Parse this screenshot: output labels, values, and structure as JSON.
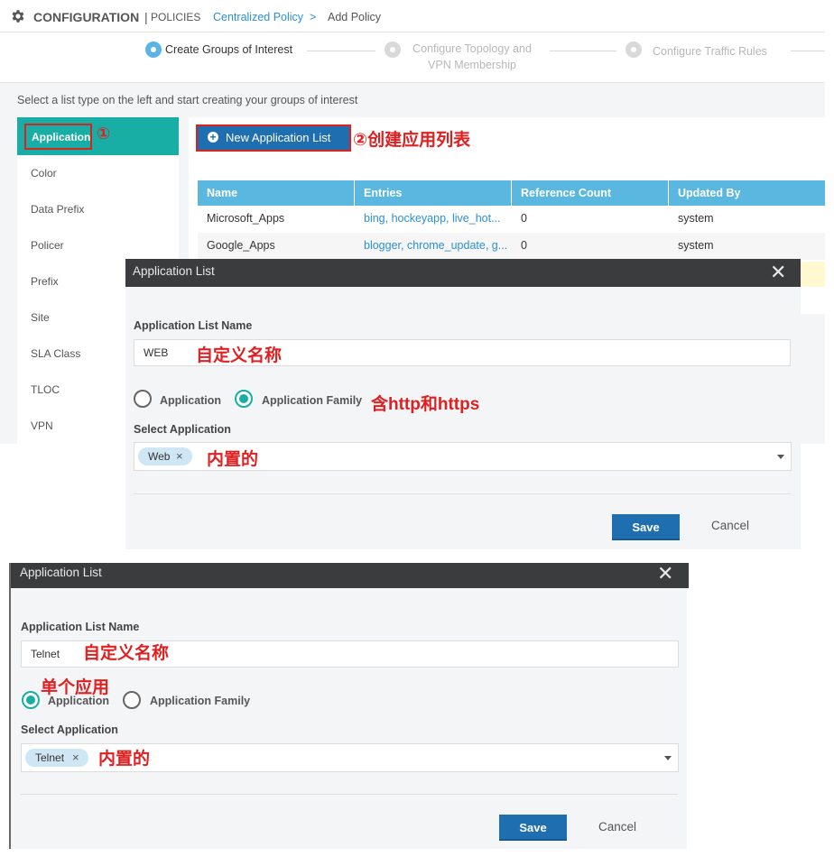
{
  "header": {
    "title": "CONFIGURATION",
    "separator": "|",
    "subtitle": "POLICIES",
    "breadcrumb_link": "Centralized Policy",
    "breadcrumb_arrow": ">",
    "breadcrumb_current": "Add Policy"
  },
  "wizard": {
    "steps": [
      {
        "label": "Create Groups of Interest",
        "active": true
      },
      {
        "label_line1": "Configure Topology and",
        "label_line2": "VPN Membership",
        "active": false
      },
      {
        "label": "Configure Traffic Rules",
        "active": false
      }
    ]
  },
  "instruction": "Select a list type on the left and start creating your groups of interest",
  "sidebar": {
    "active_item": "Application",
    "active_annotation": "①",
    "items": [
      "Color",
      "Data Prefix",
      "Policer",
      "Prefix",
      "Site",
      "SLA Class",
      "TLOC",
      "VPN"
    ]
  },
  "main": {
    "new_button_icon": "plus-circle-icon",
    "new_button_label": "New Application List",
    "new_button_annotation": "②创建应用列表",
    "table": {
      "headers": [
        "Name",
        "Entries",
        "Reference Count",
        "Updated By"
      ],
      "rows": [
        {
          "name": "Microsoft_Apps",
          "entries": "bing, hockeyapp, live_hot...",
          "ref": "0",
          "by": "system"
        },
        {
          "name": "Google_Apps",
          "entries": "blogger, chrome_update, g...",
          "ref": "0",
          "by": "system"
        }
      ]
    }
  },
  "dialog1": {
    "title": "Application List",
    "close_icon": "close-icon",
    "name_label": "Application List Name",
    "name_value": "WEB",
    "name_annotation": "自定义名称",
    "radio_application": "Application",
    "radio_family": "Application Family",
    "selected": "Application Family",
    "radio_annotation": "含http和https",
    "select_label": "Select Application",
    "chip": "Web",
    "chip_remove": "×",
    "select_annotation": "内置的",
    "save": "Save",
    "cancel": "Cancel"
  },
  "dialog2": {
    "title": "Application List",
    "close_icon": "close-icon",
    "name_label": "Application List Name",
    "name_value": "Telnet",
    "name_annotation": "自定义名称",
    "radio_annotation": "单个应用",
    "radio_application": "Application",
    "radio_family": "Application Family",
    "selected": "Application",
    "select_label": "Select Application",
    "chip": "Telnet",
    "chip_remove": "×",
    "select_annotation": "内置的",
    "save": "Save",
    "cancel": "Cancel"
  },
  "colors": {
    "accent_teal": "#18aea5",
    "primary_blue": "#1f6eb0",
    "table_header": "#5ab8e0",
    "link": "#2c8fd6",
    "annotation_red": "#e02020"
  }
}
